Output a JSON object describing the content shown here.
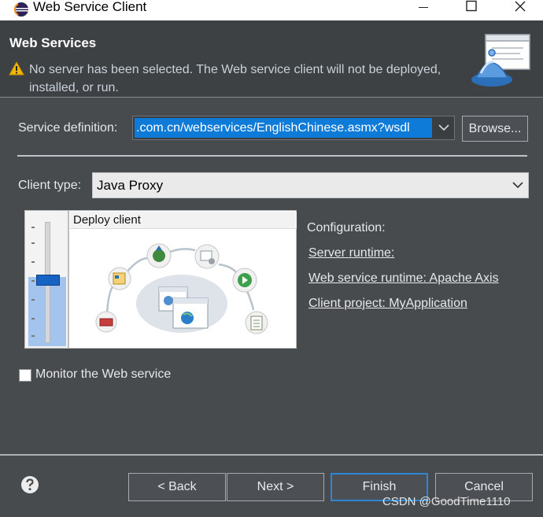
{
  "window": {
    "title": "Web Service Client",
    "icons": {
      "app": "eclipse-icon",
      "minimize": "minimize-icon",
      "maximize": "maximize-icon",
      "close": "close-icon"
    }
  },
  "header": {
    "title": "Web Services",
    "message": "No server has been selected. The Web service client will not be deployed, installed, or run.",
    "warning_icon": "warning-icon",
    "wizard_icon": "web-services-wizard-icon"
  },
  "service_definition": {
    "label": "Service definition:",
    "value": ".com.cn/webservices/EnglishChinese.asmx?wsdl",
    "browse_label": "Browse..."
  },
  "client_type": {
    "label": "Client type:",
    "value": "Java Proxy"
  },
  "deploy": {
    "label": "Deploy client",
    "level": "deploy"
  },
  "configuration": {
    "title": "Configuration:",
    "server_runtime": "Server runtime: ",
    "web_service_runtime": "Web service runtime: Apache Axis",
    "client_project": "Client project: MyApplication"
  },
  "monitor": {
    "label": "Monitor the Web service",
    "checked": false
  },
  "buttons": {
    "back": "< Back",
    "next": "Next >",
    "finish": "Finish",
    "cancel": "Cancel"
  },
  "watermark": "CSDN @GoodTime1110",
  "colors": {
    "dialog_bg": "#474b4e",
    "selection_blue": "#0f7bd9",
    "focus_border": "#2f86d6",
    "warning_yellow": "#f2b705"
  }
}
